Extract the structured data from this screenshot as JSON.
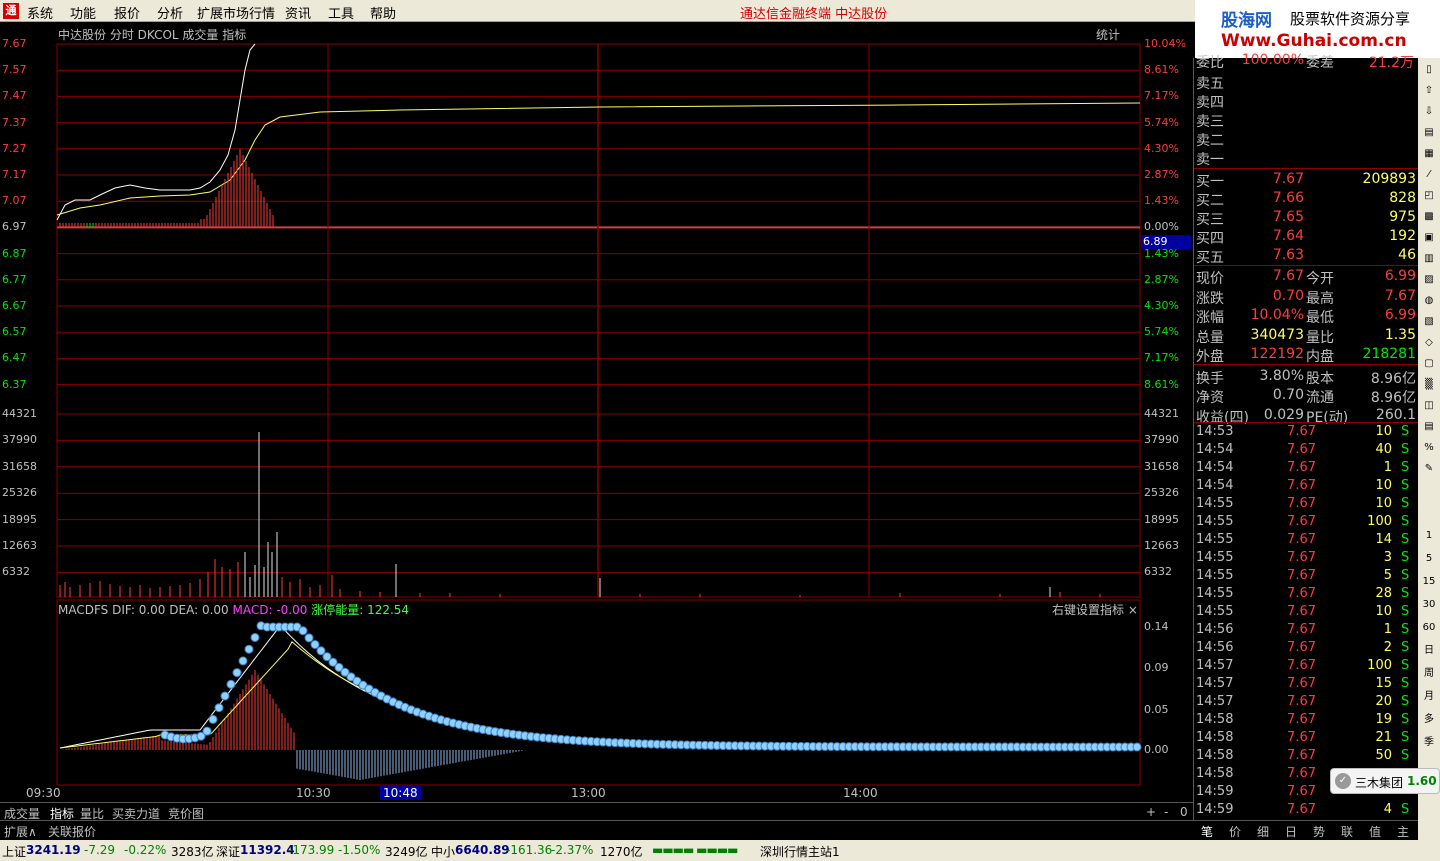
{
  "menu": {
    "items": [
      "系统",
      "功能",
      "报价",
      "分析",
      "扩展市场行情",
      "资讯",
      "工具",
      "帮助"
    ],
    "title": "通达信金融终端 中达股份"
  },
  "brand": {
    "name": "股海网",
    "slogan": "股票软件资源分享",
    "url": "Www.Guhai.com.cn"
  },
  "chart": {
    "header": "中达股份 分时 DKCOL 成交量 指标",
    "stat_btn": "统计",
    "price_labels": [
      "7.67",
      "7.57",
      "7.47",
      "7.37",
      "7.27",
      "7.17",
      "7.07",
      "6.97",
      "6.87",
      "6.77",
      "6.67",
      "6.57",
      "6.47",
      "6.37"
    ],
    "pct_labels": [
      "10.04%",
      "8.61%",
      "7.17%",
      "5.74%",
      "4.30%",
      "2.87%",
      "1.43%",
      "0.00%",
      "1.43%",
      "2.87%",
      "4.30%",
      "5.74%",
      "7.17%",
      "8.61%"
    ],
    "cursor_price": "6.89",
    "vol_labels": [
      "44321",
      "37990",
      "31658",
      "25326",
      "18995",
      "12663",
      "6332"
    ],
    "macd_header": {
      "name": "MACDFS",
      "dif": "DIF: 0.00",
      "dea": "DEA: 0.00",
      "macd": "MACD: -0.00",
      "energy": "涨停能量: 122.54"
    },
    "macd_hint": "右键设置指标 ×",
    "macd_labels": [
      "0.14",
      "0.09",
      "0.05",
      "0.00"
    ],
    "time_labels": [
      "09:30",
      "10:30",
      "10:48",
      "13:00",
      "14:00"
    ],
    "colors": {
      "up": "#ff3c3c",
      "down": "#00e600",
      "grid": "#8b0000",
      "price_line": "#ffffff",
      "avg_line": "#ffff60"
    }
  },
  "bottom_tabs": [
    "成交量",
    "指标",
    "量比",
    "买卖力道",
    "竞价图"
  ],
  "bottom_tabs2": [
    "扩展∧",
    "关联报价"
  ],
  "status": {
    "sh_name": "上证",
    "sh_val": "3241.19",
    "sh_chg": "-7.29",
    "sh_pct": "-0.22%",
    "sh_amt": "3283亿",
    "sz_name": "深证",
    "sz_val": "11392.4",
    "sz_chg": "-173.99",
    "sz_pct": "-1.50%",
    "sz_amt": "3249亿",
    "zx_name": "中小",
    "zx_val": "6640.89",
    "zx_chg": "-161.36",
    "zx_pct": "-2.37%",
    "zx_amt": "1270亿",
    "server": "深圳行情主站1"
  },
  "quote": {
    "weibi": {
      "label": "委比",
      "val": "100.00%",
      "label2": "委差",
      "val2": "21.2万"
    },
    "sells": [
      {
        "l": "卖五"
      },
      {
        "l": "卖四"
      },
      {
        "l": "卖三"
      },
      {
        "l": "卖二"
      },
      {
        "l": "卖一"
      }
    ],
    "buys": [
      {
        "l": "买一",
        "p": "7.67",
        "v": "209893"
      },
      {
        "l": "买二",
        "p": "7.66",
        "v": "828"
      },
      {
        "l": "买三",
        "p": "7.65",
        "v": "975"
      },
      {
        "l": "买四",
        "p": "7.64",
        "v": "192"
      },
      {
        "l": "买五",
        "p": "7.63",
        "v": "46"
      }
    ],
    "stats": [
      {
        "l": "现价",
        "v": "7.67",
        "l2": "今开",
        "v2": "6.99"
      },
      {
        "l": "涨跌",
        "v": "0.70",
        "l2": "最高",
        "v2": "7.67"
      },
      {
        "l": "涨幅",
        "v": "10.04%",
        "l2": "最低",
        "v2": "6.99"
      },
      {
        "l": "总量",
        "v": "340473",
        "l2": "量比",
        "v2": "1.35"
      },
      {
        "l": "外盘",
        "v": "122192",
        "l2": "内盘",
        "v2": "218281"
      },
      {
        "l": "换手",
        "v": "3.80%",
        "l2": "股本",
        "v2": "8.96亿"
      },
      {
        "l": "净资",
        "v": "0.70",
        "l2": "流通",
        "v2": "8.96亿"
      },
      {
        "l": "收益(四)",
        "v": "0.029",
        "l2": "PE(动)",
        "v2": "260.1"
      }
    ],
    "ticks": [
      [
        "14:53",
        "7.67",
        "10",
        "S"
      ],
      [
        "14:54",
        "7.67",
        "40",
        "S"
      ],
      [
        "14:54",
        "7.67",
        "1",
        "S"
      ],
      [
        "14:54",
        "7.67",
        "10",
        "S"
      ],
      [
        "14:55",
        "7.67",
        "10",
        "S"
      ],
      [
        "14:55",
        "7.67",
        "100",
        "S"
      ],
      [
        "14:55",
        "7.67",
        "14",
        "S"
      ],
      [
        "14:55",
        "7.67",
        "3",
        "S"
      ],
      [
        "14:55",
        "7.67",
        "5",
        "S"
      ],
      [
        "14:55",
        "7.67",
        "28",
        "S"
      ],
      [
        "14:55",
        "7.67",
        "10",
        "S"
      ],
      [
        "14:56",
        "7.67",
        "1",
        "S"
      ],
      [
        "14:56",
        "7.67",
        "2",
        "S"
      ],
      [
        "14:57",
        "7.67",
        "100",
        "S"
      ],
      [
        "14:57",
        "7.67",
        "15",
        "S"
      ],
      [
        "14:57",
        "7.67",
        "20",
        "S"
      ],
      [
        "14:58",
        "7.67",
        "19",
        "S"
      ],
      [
        "14:58",
        "7.67",
        "21",
        "S"
      ],
      [
        "14:58",
        "7.67",
        "50",
        "S"
      ],
      [
        "14:58",
        "7.67",
        "",
        ""
      ],
      [
        "14:59",
        "7.67",
        "",
        ""
      ],
      [
        "14:59",
        "7.67",
        "4",
        "S"
      ]
    ]
  },
  "right_tabs": [
    "笔",
    "价",
    "细",
    "日",
    "势",
    "联",
    "值",
    "主"
  ],
  "toolbar": [
    "1",
    "5",
    "15",
    "30",
    "60",
    "日",
    "周",
    "月",
    "多",
    "季"
  ],
  "badge": {
    "label": "三木集团",
    "val": "1.60"
  }
}
